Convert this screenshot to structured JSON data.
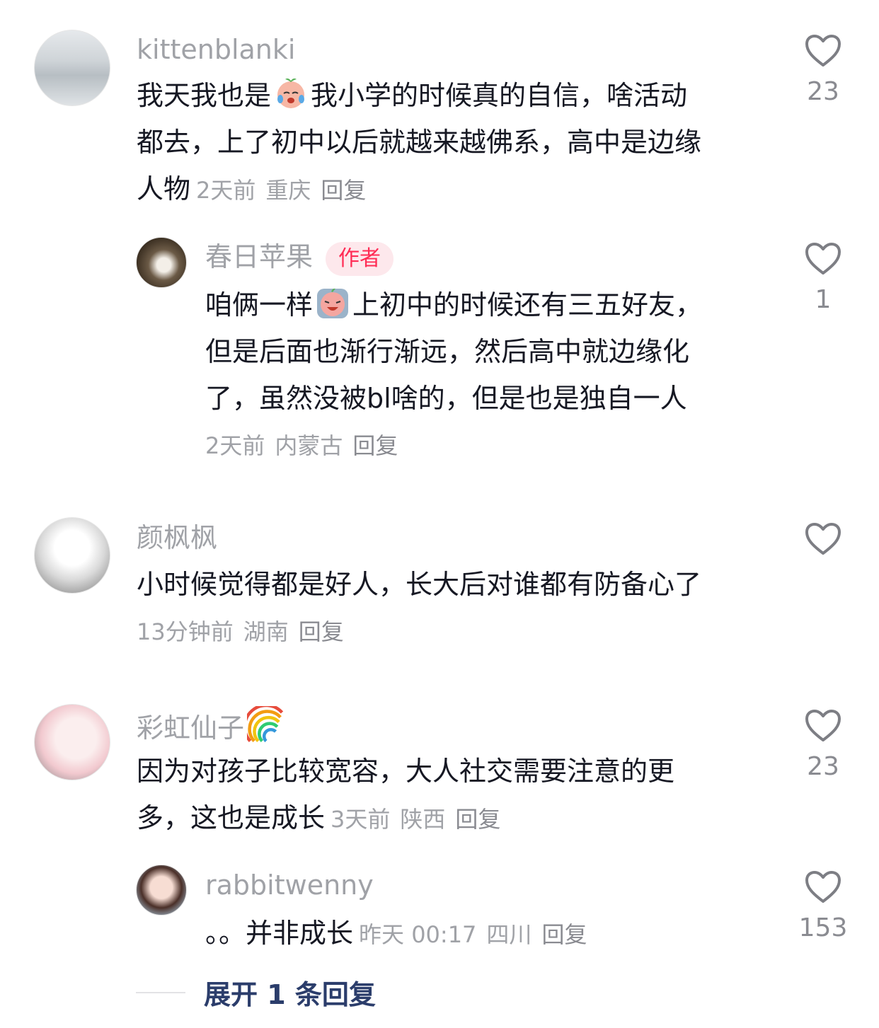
{
  "comments": [
    {
      "username": "kittenblanki",
      "lines": [
        "我天我也是",
        "我小学的时候真的自信，啥活动",
        "都去，上了初中以后就越来越佛系，高中是边缘",
        "人物"
      ],
      "time": "2天前",
      "location": "重庆",
      "reply": "回复",
      "likes": "23",
      "replies": [
        {
          "username": "春日苹果",
          "badge": "作者",
          "lines": [
            "咱俩一样",
            "上初中的时候还有三五好友，",
            "但是后面也渐行渐远，然后高中就边缘化",
            "了，虽然没被bl啥的，但是也是独自一人"
          ],
          "time": "2天前",
          "location": "内蒙古",
          "reply": "回复",
          "likes": "1"
        }
      ]
    },
    {
      "username": "颜枫枫",
      "lines": [
        "小时候觉得都是好人，长大后对谁都有防备心了"
      ],
      "time": "13分钟前",
      "location": "湖南",
      "reply": "回复",
      "likes": ""
    },
    {
      "username": "彩虹仙子",
      "lines": [
        "因为对孩子比较宽容，大人社交需要注意的更",
        "多，这也是成长"
      ],
      "time": "3天前",
      "location": "陕西",
      "reply": "回复",
      "likes": "23",
      "replies": [
        {
          "username": "rabbitwenny",
          "lines": [
            "。。并非成长"
          ],
          "time": "昨天 00:17",
          "location": "四川",
          "reply": "回复",
          "likes": "153"
        }
      ]
    }
  ],
  "expand_replies": "展开 1 条回复",
  "colors": {
    "secondary_text": "#a0a2a7",
    "badge_text": "#ff2c55",
    "badge_bg": "#fde8ec",
    "link": "#2b3d6b"
  },
  "icons": {
    "like": "heart-outline-icon",
    "emoji_cry_laugh": "crying-face-emoji",
    "emoji_crying": "sobbing-face-emoji",
    "rainbow": "rainbow-emoji"
  }
}
